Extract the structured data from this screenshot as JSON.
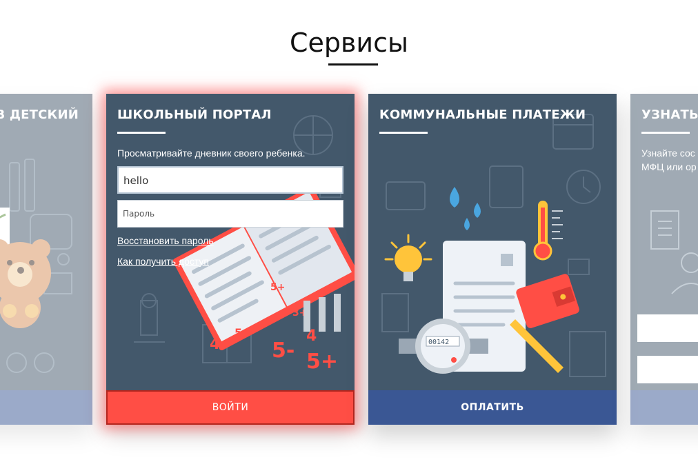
{
  "page": {
    "title": "Сервисы"
  },
  "cards": [
    {
      "title": "И В ДЕТСКИЙ"
    },
    {
      "title": "ШКОЛЬНЫЙ ПОРТАЛ",
      "description": "Просматривайте дневник своего ребенка.",
      "login_value": "hello",
      "password_placeholder": "Пароль",
      "restore_link": "Восстановить пароль",
      "access_link": "Как получить доступ",
      "button_label": "ВОЙТИ",
      "illustration_marks": [
        "5+",
        "3+",
        "4",
        "5+",
        "5-",
        "4",
        "5+"
      ]
    },
    {
      "title": "КОММУНАЛЬНЫЕ ПЛАТЕЖИ",
      "button_label": "ОПЛАТИТЬ",
      "meter_reading": "00142"
    },
    {
      "title": "УЗНАТЬ С",
      "description": "Узнайте сос\nМФЦ или ор"
    }
  ],
  "colors": {
    "card_bg": "#43586b",
    "accent_red": "#ff4e45",
    "accent_blue": "#3a5794"
  },
  "icons": [
    "teddy-bear-icon",
    "book-icon",
    "pencils-icon",
    "water-drop-icon",
    "thermometer-icon",
    "light-bulb-icon",
    "wallet-icon",
    "water-meter-icon",
    "receipt-icon"
  ]
}
